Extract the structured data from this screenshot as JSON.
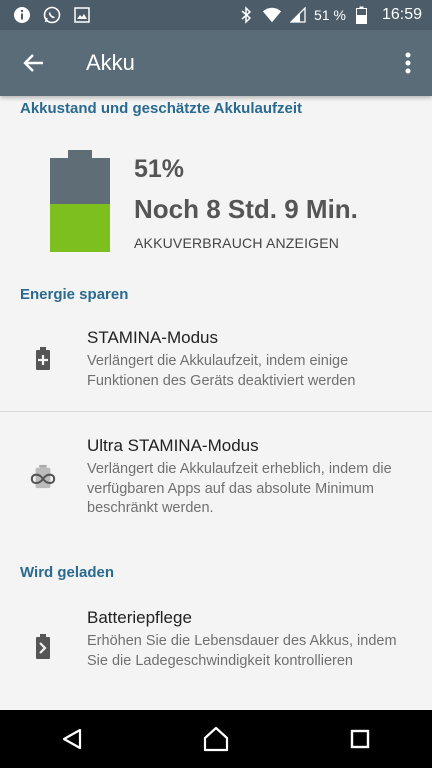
{
  "status_bar": {
    "battery_percent": "51 %",
    "time": "16:59",
    "icons": [
      "info-icon",
      "whatsapp-icon",
      "image-icon",
      "bluetooth-icon",
      "wifi-icon",
      "signal-icon",
      "battery-icon"
    ]
  },
  "toolbar": {
    "title": "Akku",
    "back_icon": "arrow-back-icon",
    "menu_icon": "more-vert-icon"
  },
  "battery_section": {
    "header": "Akkustand und geschätzte Akkulaufzeit",
    "level": 0.51,
    "percent": "51%",
    "remaining": "Noch 8 Std. 9 Min.",
    "usage_link": "AKKUVERBRAUCH ANZEIGEN"
  },
  "power_section": {
    "header": "Energie sparen",
    "items": [
      {
        "title": "STAMINA-Modus",
        "summary": "Verlängert die Akkulaufzeit, indem einige Funktionen des Geräts deaktiviert werden",
        "icon": "battery-plus-icon"
      },
      {
        "title": "Ultra STAMINA-Modus",
        "summary": "Verlängert die Akkulaufzeit erheblich, indem die verfügbaren Apps auf das absolute Minimum beschränkt werden.",
        "icon": "infinity-battery-icon"
      }
    ]
  },
  "charging_section": {
    "header": "Wird geladen",
    "items": [
      {
        "title": "Batteriepflege",
        "summary": "Erhöhen Sie die Lebensdauer des Akkus, indem Sie die Ladegeschwindigkeit kontrollieren",
        "icon": "battery-care-icon"
      }
    ]
  },
  "colors": {
    "status_bar": "#4c5d69",
    "toolbar": "#5a6c78",
    "accent": "#2b6a8f",
    "battery_fill": "#7cbf1e",
    "battery_empty": "#5f6d76"
  }
}
